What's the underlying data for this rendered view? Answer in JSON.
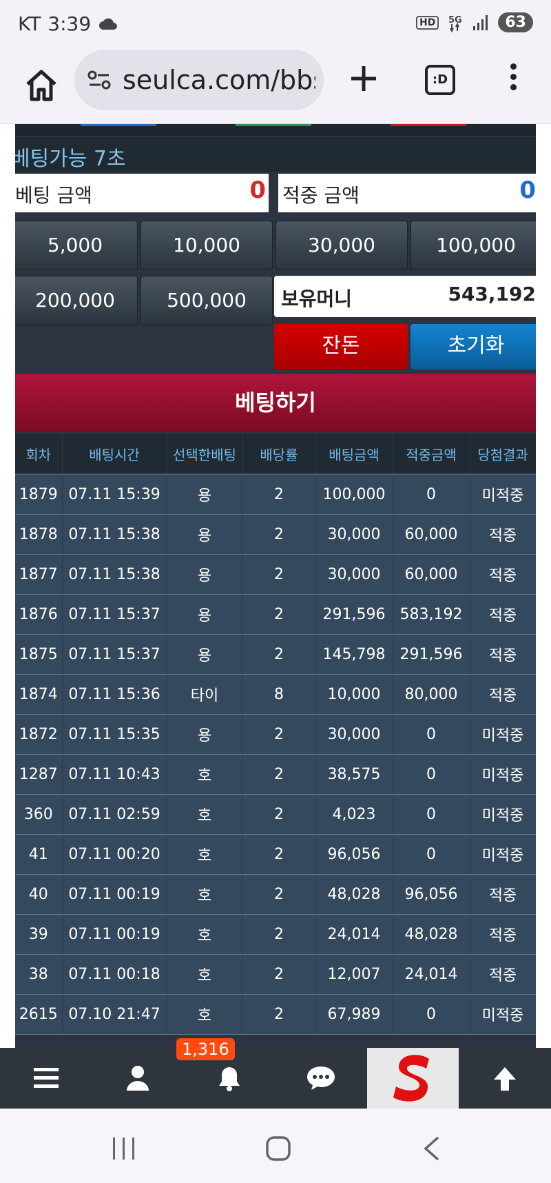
{
  "status_bar": {
    "carrier": "KT",
    "time": "3:39",
    "battery": "63"
  },
  "browser": {
    "url": "seulca.com/bbs"
  },
  "game": {
    "timer_text": "베팅가능 7초",
    "bet_amount_label": "베팅 금액",
    "bet_amount_value": "0",
    "win_amount_label": "적중 금액",
    "win_amount_value": "0",
    "chips": [
      "5,000",
      "10,000",
      "30,000",
      "100,000",
      "200,000",
      "500,000"
    ],
    "holding_label": "보유머니",
    "holding_value": "543,192",
    "change_button": "잔돈",
    "reset_button": "초기화",
    "submit_button": "베팅하기"
  },
  "history": {
    "headers": [
      "회차",
      "배팅시간",
      "선택한배팅",
      "배당률",
      "배팅금액",
      "적중금액",
      "당첨결과"
    ],
    "rows": [
      [
        "1879",
        "07.11 15:39",
        "용",
        "2",
        "100,000",
        "0",
        "미적중"
      ],
      [
        "1878",
        "07.11 15:38",
        "용",
        "2",
        "30,000",
        "60,000",
        "적중"
      ],
      [
        "1877",
        "07.11 15:38",
        "용",
        "2",
        "30,000",
        "60,000",
        "적중"
      ],
      [
        "1876",
        "07.11 15:37",
        "용",
        "2",
        "291,596",
        "583,192",
        "적중"
      ],
      [
        "1875",
        "07.11 15:37",
        "용",
        "2",
        "145,798",
        "291,596",
        "적중"
      ],
      [
        "1874",
        "07.11 15:36",
        "타이",
        "8",
        "10,000",
        "80,000",
        "적중"
      ],
      [
        "1872",
        "07.11 15:35",
        "용",
        "2",
        "30,000",
        "0",
        "미적중"
      ],
      [
        "1287",
        "07.11 10:43",
        "호",
        "2",
        "38,575",
        "0",
        "미적중"
      ],
      [
        "360",
        "07.11 02:59",
        "호",
        "2",
        "4,023",
        "0",
        "미적중"
      ],
      [
        "41",
        "07.11 00:20",
        "호",
        "2",
        "96,056",
        "0",
        "미적중"
      ],
      [
        "40",
        "07.11 00:19",
        "호",
        "2",
        "48,028",
        "96,056",
        "적중"
      ],
      [
        "39",
        "07.11 00:19",
        "호",
        "2",
        "24,014",
        "48,028",
        "적중"
      ],
      [
        "38",
        "07.11 00:18",
        "호",
        "2",
        "12,007",
        "24,014",
        "적중"
      ],
      [
        "2615",
        "07.10 21:47",
        "호",
        "2",
        "67,989",
        "0",
        "미적중"
      ]
    ]
  },
  "bottom_nav": {
    "notification_count": "1,316"
  },
  "colors": {
    "bet_value": "#d42a2a",
    "win_value": "#1a6fd0",
    "change_button": "#c00000",
    "reset_button": "#0c6fb5",
    "lose": "#d42a2a",
    "win": "#1fa040"
  }
}
